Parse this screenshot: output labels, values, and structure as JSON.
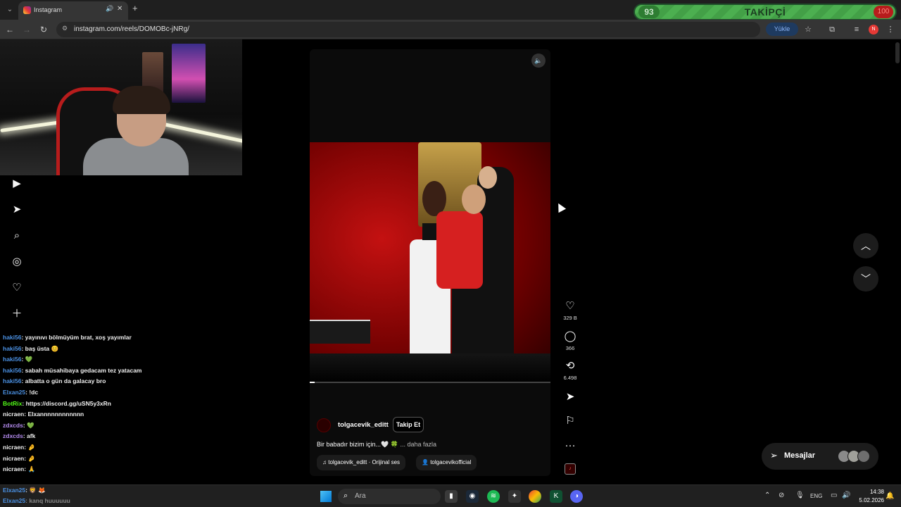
{
  "browser": {
    "tab_title": "Instagram",
    "url": "instagram.com/reels/DOMOBc-jNRg/",
    "yukle_label": "Yükle"
  },
  "follower_goal": {
    "count": "93",
    "label": "TAKİPÇİ",
    "goal": "100",
    "progress": 0.93,
    "color": "#4caf50"
  },
  "instagram_nav": [
    {
      "icon": "reels-icon"
    },
    {
      "icon": "send-icon"
    },
    {
      "icon": "search-icon"
    },
    {
      "icon": "explore-icon"
    },
    {
      "icon": "notifications-icon"
    },
    {
      "icon": "create-icon"
    }
  ],
  "chat": [
    {
      "user": "",
      "text": "",
      "color": "#f0f0f0"
    },
    {
      "user": "haki56",
      "text": ": yayınıvı bölmüyüm brat, xoş yayımlar",
      "color": "#4a90e2"
    },
    {
      "user": "haki56",
      "text": ": baş üsta 😊",
      "color": "#4a90e2"
    },
    {
      "user": "haki56",
      "text": ": 💚",
      "color": "#4a90e2"
    },
    {
      "user": "haki56",
      "text": ": sabah müsahibaya gedacam tez yatacam",
      "color": "#4a90e2"
    },
    {
      "user": "haki56",
      "text": ": albatta o gün da galacay bro",
      "color": "#4a90e2"
    },
    {
      "user": "Elxan25",
      "text": ": !dc",
      "color": "#4a90e2"
    },
    {
      "user": "BotRix",
      "text": ": https://discord.gg/uSN5y3xRn",
      "color": "#53fc18"
    },
    {
      "user": "nicraen",
      "text": ": Elxannnnnnnnnnnn",
      "color": "#f0f0f0"
    },
    {
      "user": "zdxcds",
      "text": ": 💚",
      "color": "#b58cf0"
    },
    {
      "user": "zdxcds",
      "text": ": afk",
      "color": "#b58cf0"
    },
    {
      "user": "nicraen",
      "text": ": 🤌",
      "color": "#f0f0f0"
    },
    {
      "user": "nicraen",
      "text": ": 🤌",
      "color": "#f0f0f0"
    },
    {
      "user": "nicraen",
      "text": ": 🙏",
      "color": "#f0f0f0"
    }
  ],
  "reel": {
    "author": "tolgacevik_editt",
    "follow_label": "Takip Et",
    "caption": "Bir babadır bizim için...🤍 🍀",
    "more_label": "... daha fazla",
    "audio": "tolgacevik_editt · Orijinal ses",
    "tagged": "tolgacevikofficial",
    "progress": 0.02,
    "likes": "329 B",
    "comments": "366",
    "reposts": "6.498"
  },
  "messages": {
    "label": "Mesajlar"
  },
  "taskbar": {
    "search_placeholder": "Ara",
    "language": "ENG",
    "time": "14:38",
    "date": "5.02.2026",
    "overlay_chat": [
      {
        "user": "Elxan25",
        "text": ": 🦁 🦊"
      },
      {
        "user": "Elxan25",
        "text": ": kanq huuuuuu"
      }
    ]
  }
}
